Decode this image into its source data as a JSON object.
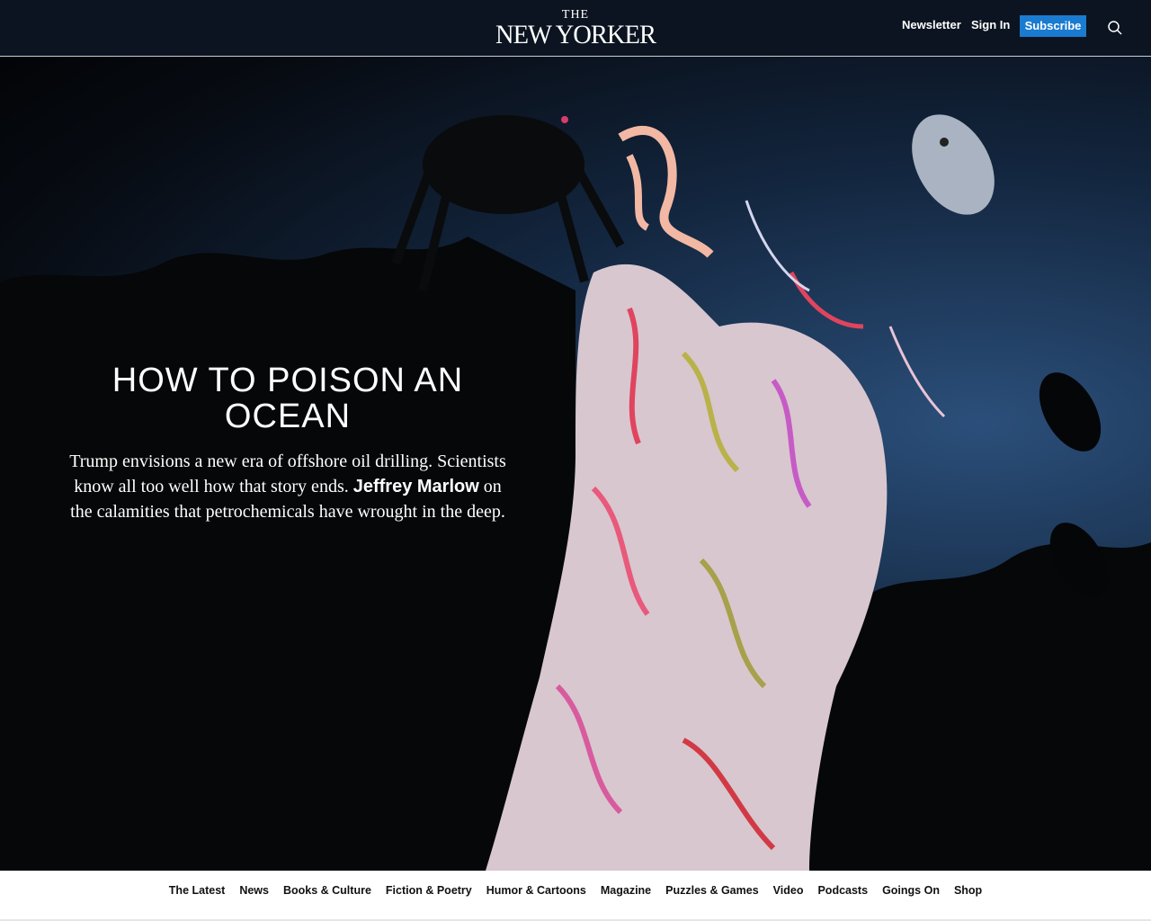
{
  "header": {
    "logo_the": "THE",
    "logo_main": "NEW YORKER",
    "newsletter": "Newsletter",
    "sign_in": "Sign In",
    "subscribe": "Subscribe",
    "search_icon": "search-icon",
    "accent_color": "#1a7bd0"
  },
  "hero": {
    "headline": "HOW TO POISON AN OCEAN",
    "dek_before": "Trump envisions a new era of offshore oil drilling. Scientists know all too well how that story ends. ",
    "author": "Jeffrey Marlow",
    "dek_after": " on the calamities that petrochemicals have wrought in the deep."
  },
  "nav": {
    "items": [
      "The Latest",
      "News",
      "Books & Culture",
      "Fiction & Poetry",
      "Humor & Cartoons",
      "Magazine",
      "Puzzles & Games",
      "Video",
      "Podcasts",
      "Goings On",
      "Shop"
    ]
  }
}
